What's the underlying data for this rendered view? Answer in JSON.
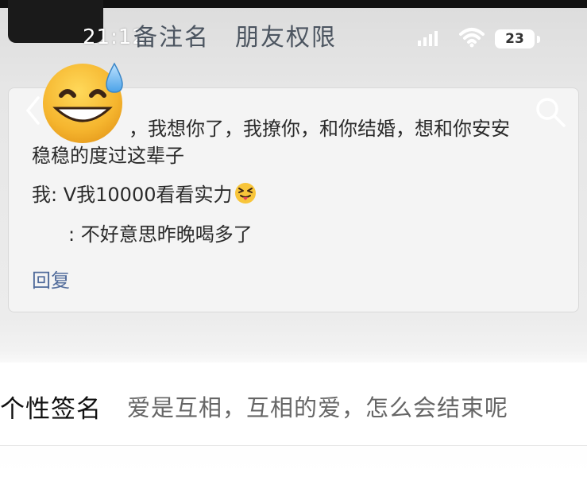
{
  "status_bar": {
    "time": "21:12",
    "battery": "23"
  },
  "header": {
    "tabs": [
      "备注名",
      "朋友权限"
    ]
  },
  "message_card": {
    "line1": "，我想你了，我撩你，和你结婚，想和你安安",
    "line1_cont": "稳稳的度过这辈子",
    "line2": "我: V我10000看看实力",
    "line3": ": 不好意思昨晚喝多了",
    "reply_label": "回复"
  },
  "signature": {
    "label": "个性签名",
    "value": "爱是互相，互相的爱，怎么会结束呢"
  },
  "colors": {
    "link": "#4f6a9a",
    "battery_bg": "#ffffff"
  },
  "icons": [
    "back-arrow-icon",
    "search-icon",
    "signal-icon",
    "wifi-icon",
    "grinning-sweat-emoji",
    "squinting-tongue-emoji"
  ]
}
